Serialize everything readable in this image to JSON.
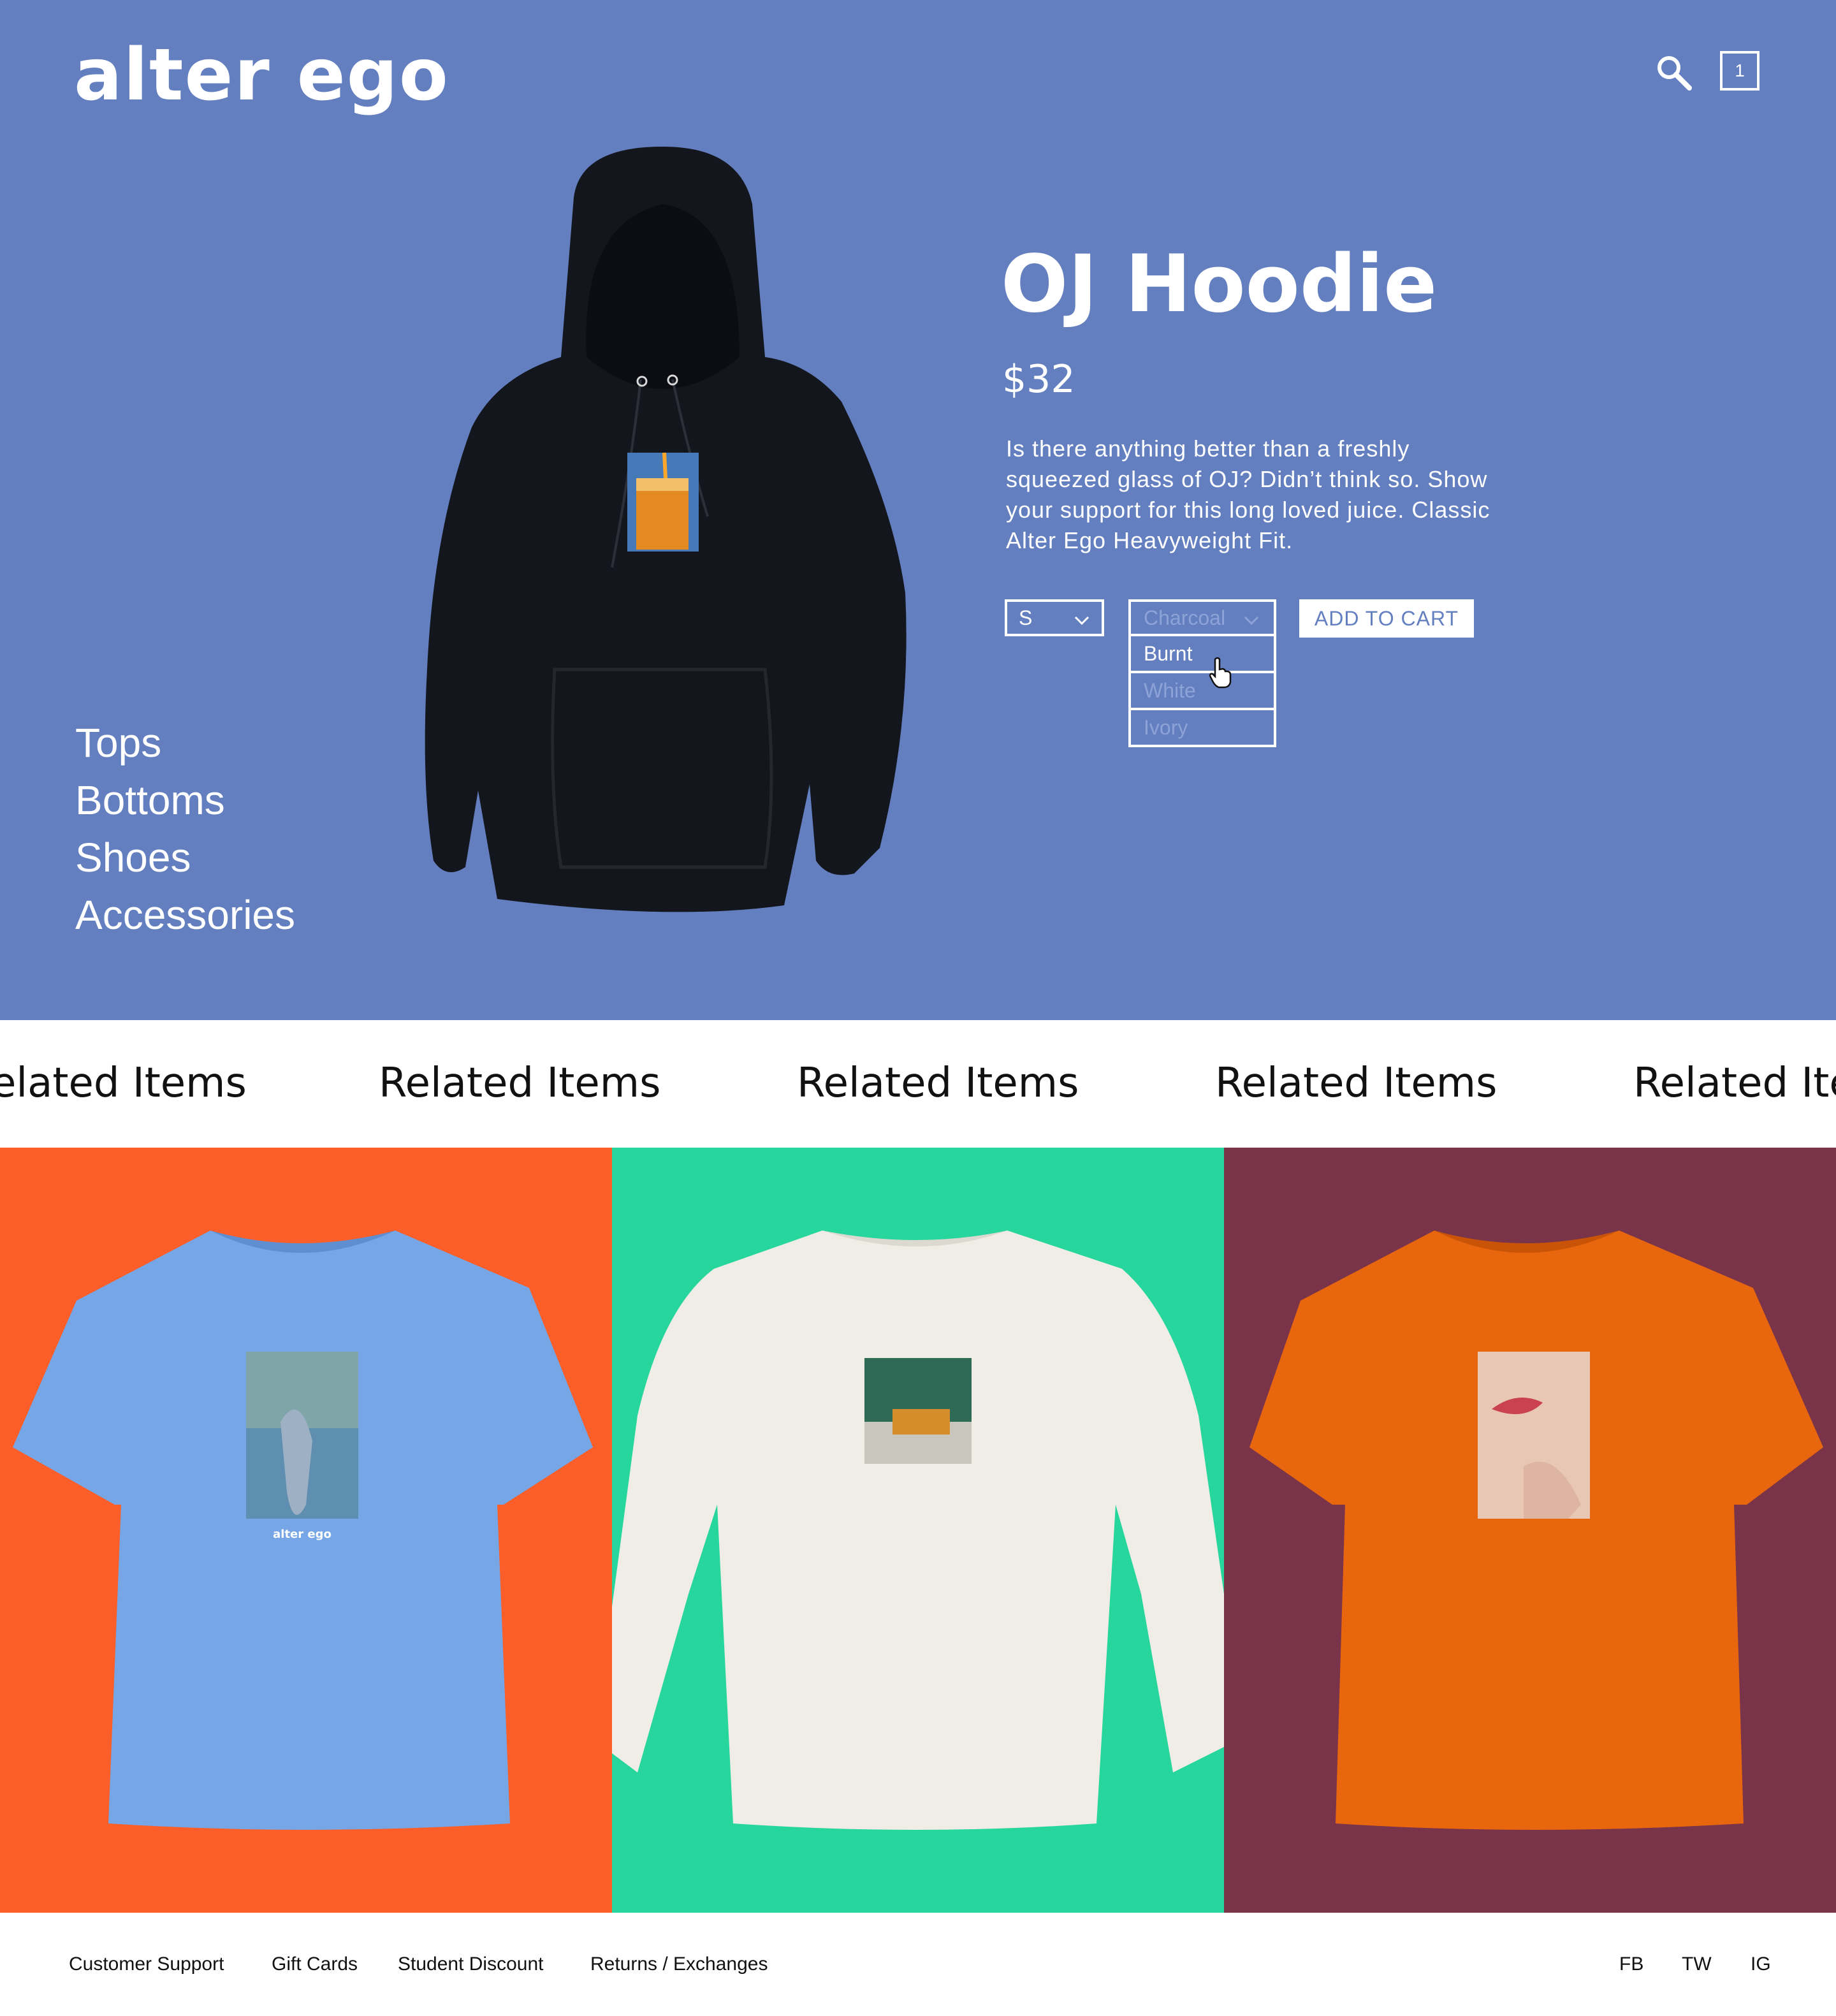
{
  "brand": {
    "logo_text": "alter ego"
  },
  "header": {
    "cart_count": "1"
  },
  "categories": [
    "Tops",
    "Bottoms",
    "Shoes",
    "Accessories"
  ],
  "product": {
    "title": "OJ Hoodie",
    "price": "$32",
    "description": "Is there anything better than a freshly squeezed glass of OJ? Didn’t think so. Show your support for this long loved juice. Classic Alter Ego Heavyweight Fit.",
    "size": {
      "selected": "S"
    },
    "color": {
      "selected": "Charcoal",
      "options": [
        "Burnt",
        "White",
        "Ivory"
      ],
      "hovered": "Burnt"
    },
    "add_to_cart_label": "ADD TO CART"
  },
  "related": {
    "heading": "Related Items",
    "heading_repeats": [
      "elated Items",
      "Related Items",
      "Related Items",
      "Related Items",
      "Related Ite"
    ],
    "items": [
      {
        "bg_color": "#fb5e28",
        "garment": "blue t-shirt"
      },
      {
        "bg_color": "#26d69d",
        "garment": "white long sleeve"
      },
      {
        "bg_color": "#7a344a",
        "garment": "orange t-shirt"
      }
    ],
    "tee_print_text": "alter ego"
  },
  "footer": {
    "links": [
      "Customer Support",
      "Gift Cards",
      "Student Discount",
      "Returns / Exchanges"
    ],
    "social": [
      "FB",
      "TW",
      "IG"
    ]
  },
  "colors": {
    "hero_bg": "#637fc0",
    "text_on_hero": "#ffffff"
  }
}
